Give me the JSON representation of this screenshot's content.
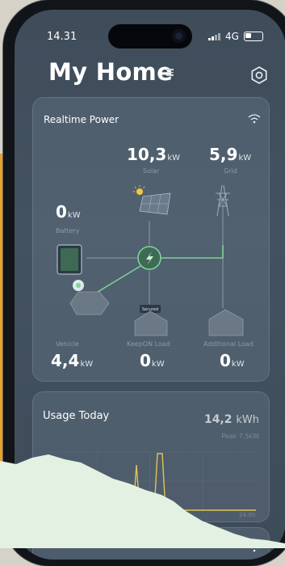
{
  "status_bar": {
    "time": "14.31",
    "network": "4G"
  },
  "header": {
    "title": "My Home"
  },
  "realtime": {
    "title": "Realtime Power",
    "solar": {
      "value": "10,3",
      "unit": "kW",
      "label": "Solar"
    },
    "grid": {
      "value": "5,9",
      "unit": "kW",
      "label": "Grid"
    },
    "battery": {
      "value": "0",
      "unit": "kW",
      "label": "Battery"
    },
    "vehicle": {
      "value": "4,4",
      "unit": "kW",
      "label": "Vehicle"
    },
    "keepon": {
      "value": "0",
      "unit": "kW",
      "label": "KeepON Load",
      "badge": "Secured"
    },
    "additional": {
      "value": "0",
      "unit": "kW",
      "label": "Additional Load"
    }
  },
  "usage": {
    "title": "Usage Today",
    "value": "14,2",
    "unit": "kWh",
    "peak": "Peak 7,5kW",
    "x_label_end": "24:00"
  },
  "colors": {
    "flow_line": "#7fd39a",
    "chart_line": "#e0c455",
    "hill": "#e3f1e3",
    "accent_orange": "#e8a12c"
  },
  "icons": [
    "wifi-icon",
    "gear-icon",
    "menu-icon",
    "solar-panel-icon",
    "grid-tower-icon",
    "battery-icon",
    "vehicle-icon",
    "house-icon",
    "lightning-icon"
  ]
}
